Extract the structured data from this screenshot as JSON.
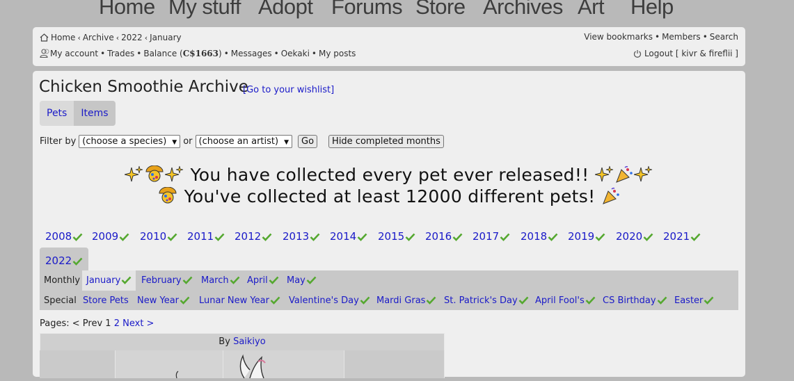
{
  "nav": [
    "Home",
    "My stuff",
    "Adopt",
    "Forums",
    "Store",
    "Archives",
    "Art",
    "Help"
  ],
  "breadcrumb": [
    "Home",
    "Archive",
    "2022",
    "January"
  ],
  "toplinks": [
    "View bookmarks",
    "Members",
    "Search"
  ],
  "userlinks": {
    "my_account": "My account",
    "trades": "Trades",
    "balance_label": "Balance (",
    "balance_value": "C$1663",
    "balance_close": ")",
    "messages": "Messages",
    "oekaki": "Oekaki",
    "my_posts": "My posts"
  },
  "logout": "Logout [ kivr & fireflii ]",
  "page_title": "Chicken Smoothie Archive",
  "wishlist_link": "[Go to your wishlist]",
  "tabs": [
    "Pets",
    "Items"
  ],
  "filter": {
    "label": "Filter by",
    "species_select": "(choose a species)",
    "or": "or",
    "artist_select": "(choose an artist)",
    "go": "Go",
    "hide_completed": "Hide completed months"
  },
  "collected_line1": "You have collected every pet ever released!!",
  "collected_line2": "You've collected at least 12000 different pets!",
  "years": [
    "2008",
    "2009",
    "2010",
    "2011",
    "2012",
    "2013",
    "2014",
    "2015",
    "2016",
    "2017",
    "2018",
    "2019",
    "2020",
    "2021",
    "2022"
  ],
  "selected_year": "2022",
  "monthly_label": "Monthly",
  "months": [
    "January",
    "February",
    "March",
    "April",
    "May"
  ],
  "special_label": "Special",
  "specials": [
    "Store Pets",
    "New Year",
    "Lunar New Year",
    "Valentine's Day",
    "Mardi Gras",
    "St. Patrick's Day",
    "April Fool's",
    "CS Birthday",
    "Easter"
  ],
  "pages": {
    "label": "Pages:",
    "prev": "< Prev",
    "current": "1",
    "page2": "2",
    "next": "Next >"
  },
  "by_label": "By",
  "artist": "Saikiyo",
  "colors": {
    "link": "#1a1ac8",
    "check": "#55a830",
    "panel": "#efefef",
    "background": "#b9b9b9"
  }
}
